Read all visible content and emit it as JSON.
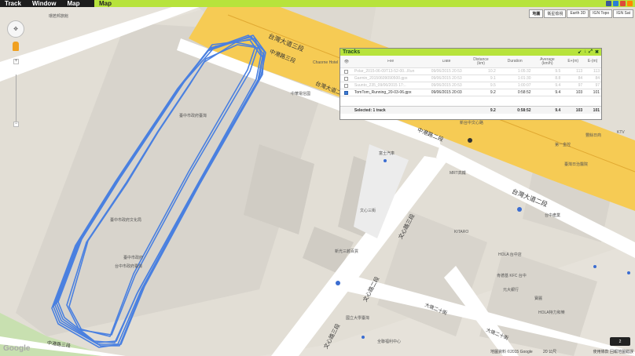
{
  "menubar": {
    "items": [
      "Track",
      "Window",
      "Map"
    ],
    "active_tab": "Map",
    "social_colors": [
      "#3b5998",
      "#2a7fd4",
      "#dd4b39",
      "#ff8800"
    ]
  },
  "map_types": [
    "地圖",
    "衛星檢視",
    "Earth 3D",
    "IGN Topo",
    "IGN Sat"
  ],
  "nav": {
    "pan_icon": "pan-arrows-icon",
    "zoom_in": "+",
    "zoom_out": "−"
  },
  "roads": {
    "taiwan_ave_top": "台灣大道三段",
    "taiwan_ave_mid": "台灣大道二段",
    "taiwan_ave_right": "台灣大道二段",
    "zhonggang_top": "中港路三段",
    "zhonggang_mid": "中港路二段",
    "wenxin_1": "文心路三段",
    "wenxin_2": "文心路二段",
    "wenxin_3": "文心路三段",
    "dadun": "大墩二十街",
    "dadun2": "大墩二十街",
    "lane": "中港路三段"
  },
  "places": {
    "p1": "環若邦旅館",
    "p2": "Chaorne Hotel",
    "p3": "中華電信國",
    "p4": "臺中市政府臺灣",
    "p5": "臺中市政府文化局",
    "p6": "臺中市政府",
    "p7": "台中市政府臺灣",
    "p8": "新光三越百貨",
    "p9": "文心三街",
    "p10": "新光三越",
    "p11": "富士汽車",
    "p12": "新台中文心路",
    "p13": "MRT高鐵",
    "p14": "KITARO",
    "p15": "HOLA 台中店",
    "p16": "肯德基 KFC 台中",
    "p17": "元大銀行",
    "p18": "第一金控",
    "p19": "豐餘日商",
    "p20": "大墩二十街",
    "p21": "臺灣日治醫院",
    "p22": "國立大學臺灣",
    "p23": "全聯福利中心",
    "p24": "台中產業",
    "p25": "HOLA特力和樂",
    "p26": "新光三越新館",
    "p27": "寶麗",
    "p28": "KTV"
  },
  "tracks_panel": {
    "title": "Tracks",
    "headers": [
      "File",
      "Date",
      "Distance\n(km)",
      "Duration",
      "Average\n(km/h)",
      "E+(m)",
      "E-(m)"
    ],
    "rows": [
      {
        "file": "Polar_2015-06-09T13-52-00...Run",
        "date": "09/06/2015 20:53",
        "distance": "10.2",
        "duration": "1:05:32",
        "avg": "9.5",
        "eplus": "113",
        "eminus": "113",
        "checked": false,
        "dim": true
      },
      {
        "file": "Garmin_20150609090500.gpx",
        "date": "09/06/2015 20:53",
        "distance": "9.1",
        "duration": "1:01:30",
        "avg": "8.8",
        "eplus": "84",
        "eminus": "84",
        "checked": false,
        "dim": true
      },
      {
        "file": "Suunto_235_09/06/2015 17:..",
        "date": "09/06/2015 20:53",
        "distance": "9.5",
        "duration": "1:00:07",
        "avg": "9.4",
        "eplus": "97",
        "eminus": "97",
        "checked": false,
        "dim": true
      },
      {
        "file": "TomTom_Running_20-03-06.gpx",
        "date": "09/06/2015 20:03",
        "distance": "9.2",
        "duration": "0:58:52",
        "avg": "9.4",
        "eplus": "103",
        "eminus": "101",
        "checked": true,
        "dim": false
      }
    ],
    "footer": {
      "label": "Selected: 1 track",
      "distance": "9.2",
      "duration": "0:58:52",
      "avg": "9.4",
      "eplus": "103",
      "eminus": "101"
    },
    "controls": [
      "↙",
      "↓",
      "⤢",
      "✖"
    ]
  },
  "footer": {
    "attribution": "地圖資料 ©2015 Google",
    "scale": "20 公尺",
    "terms": "使用條款 回報地圖錯誤",
    "google": "Google",
    "widget": "2"
  },
  "track_color": "#4a80e0"
}
